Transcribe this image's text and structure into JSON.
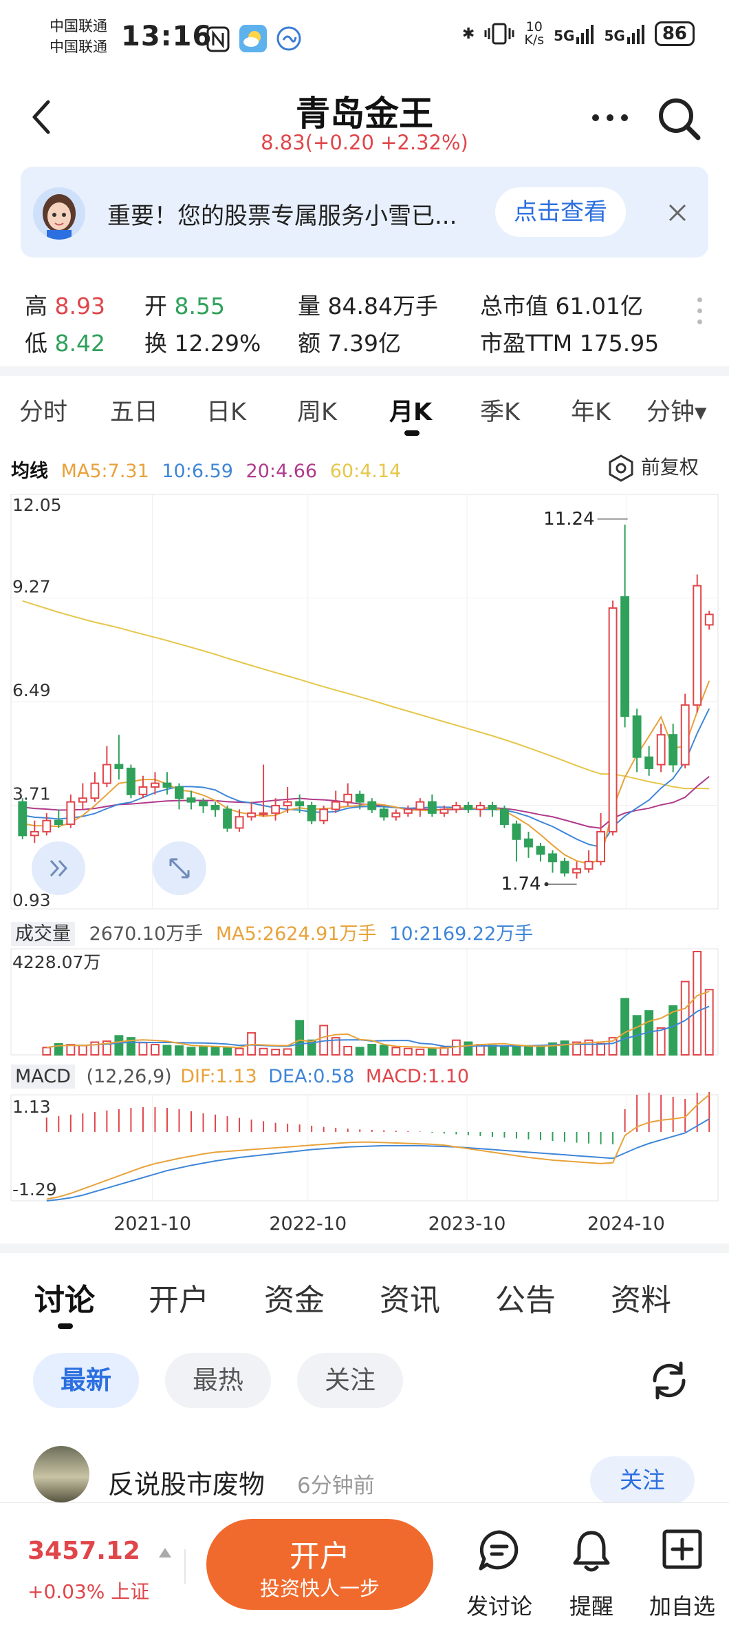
{
  "status_bar": {
    "carrier1": "中国联通",
    "carrier2": "中国联通",
    "time": "13:16",
    "net_speed_top": "10",
    "net_speed_unit": "K/s",
    "signal1": "5G",
    "signal2": "5G",
    "battery": "86"
  },
  "header": {
    "title": "青岛金王",
    "price_line": "8.83(+0.20 +2.32%)"
  },
  "banner": {
    "text": "重要！您的股票专属服务小雪已...",
    "button": "点击查看"
  },
  "quote": {
    "high_label": "高",
    "high_value": "8.93",
    "low_label": "低",
    "low_value": "8.42",
    "open_label": "开",
    "open_value": "8.55",
    "turnover_label": "换",
    "turnover_value": "12.29%",
    "volume_label": "量",
    "volume_value": "84.84万手",
    "amount_label": "额",
    "amount_value": "7.39亿",
    "mcap_label": "总市值",
    "mcap_value": "61.01亿",
    "pe_label": "市盈TTM",
    "pe_value": "175.95"
  },
  "period_tabs": [
    "分时",
    "五日",
    "日K",
    "周K",
    "月K",
    "季K",
    "年K",
    "分钟▾"
  ],
  "active_period": "月K",
  "ma_legend": {
    "label": "均线",
    "ma5": "MA5:7.31",
    "ma10": "10:6.59",
    "ma20": "20:4.66",
    "ma60": "60:4.14",
    "restore": "前复权"
  },
  "volume_legend": {
    "label": "成交量",
    "vol": "2670.10万手",
    "ma5": "MA5:2624.91万手",
    "ma10": "10:2169.22万手"
  },
  "macd_legend": {
    "label": "MACD",
    "params": "(12,26,9)",
    "dif": "DIF:1.13",
    "dea": "DEA:0.58",
    "macd": "MACD:1.10"
  },
  "colors": {
    "up": "#e0454a",
    "down": "#2fa15a",
    "ma5": "#e8a23a",
    "ma10": "#3f86d8",
    "ma20": "#b03a8c",
    "ma60": "#e6c64a",
    "accent": "#2b6fe0",
    "cta": "#f16a2d"
  },
  "chart_data": [
    {
      "type": "candlestick",
      "title": "",
      "y_ticks": [
        "12.05",
        "9.27",
        "6.49",
        "3.71",
        "0.93"
      ],
      "ylim": [
        0.93,
        12.05
      ],
      "x_ticks": [
        "2021-10",
        "2022-10",
        "2023-10",
        "2024-10"
      ],
      "annotations": [
        "11.24",
        "1.74"
      ],
      "candles": [
        {
          "o": 3.8,
          "c": 2.9,
          "h": 3.9,
          "l": 2.8
        },
        {
          "o": 2.9,
          "c": 3.0,
          "h": 3.3,
          "l": 2.7
        },
        {
          "o": 3.0,
          "c": 3.3,
          "h": 3.5,
          "l": 2.9
        },
        {
          "o": 3.3,
          "c": 3.2,
          "h": 3.6,
          "l": 3.1
        },
        {
          "o": 3.2,
          "c": 3.8,
          "h": 4.0,
          "l": 3.1
        },
        {
          "o": 3.8,
          "c": 3.9,
          "h": 4.3,
          "l": 3.6
        },
        {
          "o": 3.9,
          "c": 4.3,
          "h": 4.6,
          "l": 3.8
        },
        {
          "o": 4.3,
          "c": 4.8,
          "h": 5.3,
          "l": 4.2
        },
        {
          "o": 4.8,
          "c": 4.7,
          "h": 5.6,
          "l": 4.4
        },
        {
          "o": 4.7,
          "c": 4.0,
          "h": 4.8,
          "l": 3.9
        },
        {
          "o": 4.0,
          "c": 4.2,
          "h": 4.5,
          "l": 3.9
        },
        {
          "o": 4.2,
          "c": 4.3,
          "h": 4.6,
          "l": 4.0
        },
        {
          "o": 4.3,
          "c": 4.2,
          "h": 4.6,
          "l": 4.0
        },
        {
          "o": 4.2,
          "c": 3.9,
          "h": 4.3,
          "l": 3.6
        },
        {
          "o": 3.9,
          "c": 3.8,
          "h": 4.1,
          "l": 3.6
        },
        {
          "o": 3.8,
          "c": 3.7,
          "h": 3.9,
          "l": 3.5
        },
        {
          "o": 3.7,
          "c": 3.6,
          "h": 3.8,
          "l": 3.4
        },
        {
          "o": 3.6,
          "c": 3.1,
          "h": 3.7,
          "l": 3.0
        },
        {
          "o": 3.1,
          "c": 3.4,
          "h": 3.6,
          "l": 3.0
        },
        {
          "o": 3.4,
          "c": 3.5,
          "h": 3.8,
          "l": 3.3
        },
        {
          "o": 3.5,
          "c": 3.5,
          "h": 4.8,
          "l": 3.4
        },
        {
          "o": 3.5,
          "c": 3.7,
          "h": 3.9,
          "l": 3.3
        },
        {
          "o": 3.7,
          "c": 3.8,
          "h": 4.2,
          "l": 3.5
        },
        {
          "o": 3.8,
          "c": 3.7,
          "h": 4.0,
          "l": 3.5
        },
        {
          "o": 3.7,
          "c": 3.3,
          "h": 3.8,
          "l": 3.2
        },
        {
          "o": 3.3,
          "c": 3.6,
          "h": 3.7,
          "l": 3.2
        },
        {
          "o": 3.6,
          "c": 3.8,
          "h": 4.1,
          "l": 3.5
        },
        {
          "o": 3.8,
          "c": 4.0,
          "h": 4.3,
          "l": 3.7
        },
        {
          "o": 4.0,
          "c": 3.8,
          "h": 4.1,
          "l": 3.6
        },
        {
          "o": 3.8,
          "c": 3.6,
          "h": 3.9,
          "l": 3.5
        },
        {
          "o": 3.6,
          "c": 3.4,
          "h": 3.7,
          "l": 3.3
        },
        {
          "o": 3.4,
          "c": 3.5,
          "h": 3.6,
          "l": 3.3
        },
        {
          "o": 3.5,
          "c": 3.6,
          "h": 3.7,
          "l": 3.4
        },
        {
          "o": 3.6,
          "c": 3.8,
          "h": 3.9,
          "l": 3.4
        },
        {
          "o": 3.8,
          "c": 3.5,
          "h": 4.0,
          "l": 3.4
        },
        {
          "o": 3.5,
          "c": 3.6,
          "h": 3.7,
          "l": 3.4
        },
        {
          "o": 3.6,
          "c": 3.7,
          "h": 3.8,
          "l": 3.5
        },
        {
          "o": 3.7,
          "c": 3.6,
          "h": 3.8,
          "l": 3.5
        },
        {
          "o": 3.6,
          "c": 3.7,
          "h": 3.8,
          "l": 3.4
        },
        {
          "o": 3.7,
          "c": 3.6,
          "h": 3.8,
          "l": 3.4
        },
        {
          "o": 3.6,
          "c": 3.2,
          "h": 3.7,
          "l": 3.1
        },
        {
          "o": 3.2,
          "c": 2.8,
          "h": 3.3,
          "l": 2.2
        },
        {
          "o": 2.8,
          "c": 2.6,
          "h": 3.0,
          "l": 2.3
        },
        {
          "o": 2.6,
          "c": 2.4,
          "h": 2.7,
          "l": 2.2
        },
        {
          "o": 2.4,
          "c": 2.2,
          "h": 2.5,
          "l": 1.9
        },
        {
          "o": 2.2,
          "c": 1.9,
          "h": 2.3,
          "l": 1.8
        },
        {
          "o": 1.9,
          "c": 2.0,
          "h": 2.2,
          "l": 1.74
        },
        {
          "o": 2.0,
          "c": 2.2,
          "h": 2.5,
          "l": 1.9
        },
        {
          "o": 2.2,
          "c": 3.0,
          "h": 3.5,
          "l": 2.1
        },
        {
          "o": 3.0,
          "c": 9.0,
          "h": 9.2,
          "l": 2.9
        },
        {
          "o": 9.3,
          "c": 6.1,
          "h": 11.24,
          "l": 5.8
        },
        {
          "o": 6.1,
          "c": 5.0,
          "h": 6.3,
          "l": 4.6
        },
        {
          "o": 5.0,
          "c": 4.7,
          "h": 5.3,
          "l": 4.5
        },
        {
          "o": 4.8,
          "c": 5.6,
          "h": 5.9,
          "l": 4.6
        },
        {
          "o": 5.6,
          "c": 4.8,
          "h": 5.9,
          "l": 4.6
        },
        {
          "o": 4.8,
          "c": 6.4,
          "h": 6.7,
          "l": 4.7
        },
        {
          "o": 6.4,
          "c": 9.6,
          "h": 9.9,
          "l": 6.2
        },
        {
          "o": 8.55,
          "c": 8.83,
          "h": 8.93,
          "l": 8.42
        }
      ]
    },
    {
      "type": "bar",
      "title": "",
      "y_ticks": [
        "4228.07万"
      ],
      "unit": "万手",
      "values": [
        300,
        450,
        420,
        380,
        520,
        560,
        780,
        700,
        500,
        420,
        380,
        360,
        300,
        350,
        330,
        280,
        260,
        900,
        260,
        220,
        240,
        1400,
        600,
        1200,
        700,
        340,
        300,
        420,
        380,
        300,
        260,
        230,
        260,
        300,
        600,
        520,
        420,
        380,
        360,
        320,
        360,
        340,
        480,
        560,
        520,
        600,
        460,
        700,
        2300,
        1600,
        1800,
        1100,
        2000,
        3000,
        4228,
        2670
      ],
      "directions": [
        "d",
        "u",
        "u",
        "d",
        "u",
        "u",
        "u",
        "u",
        "d",
        "d",
        "u",
        "u",
        "d",
        "d",
        "d",
        "d",
        "d",
        "d",
        "u",
        "u",
        "u",
        "d",
        "u",
        "u",
        "d",
        "u",
        "u",
        "u",
        "d",
        "d",
        "d",
        "u",
        "u",
        "u",
        "d",
        "u",
        "u",
        "d",
        "u",
        "d",
        "d",
        "d",
        "d",
        "d",
        "d",
        "d",
        "u",
        "u",
        "u",
        "d",
        "d",
        "d",
        "u",
        "d",
        "u",
        "u",
        "u",
        "d"
      ]
    },
    {
      "type": "bar",
      "title": "",
      "y_ticks": [
        "1.13",
        "-1.29"
      ],
      "ylim": [
        -1.29,
        1.13
      ],
      "hist": [
        0.35,
        0.38,
        0.42,
        0.45,
        0.48,
        0.52,
        0.55,
        0.58,
        0.6,
        0.6,
        0.58,
        0.55,
        0.5,
        0.45,
        0.42,
        0.38,
        0.34,
        0.3,
        0.26,
        0.22,
        0.2,
        0.18,
        0.15,
        0.12,
        0.1,
        0.08,
        0.06,
        0.05,
        0.04,
        0.03,
        0.02,
        0.01,
        -0.02,
        -0.04,
        -0.06,
        -0.08,
        -0.1,
        -0.12,
        -0.14,
        -0.16,
        -0.18,
        -0.2,
        -0.22,
        -0.24,
        -0.26,
        -0.28,
        -0.3,
        -0.3,
        0.55,
        0.9,
        0.95,
        0.9,
        0.85,
        0.8,
        0.95,
        1.1
      ],
      "dif": [
        -1.25,
        -1.2,
        -1.12,
        -1.02,
        -0.92,
        -0.82,
        -0.72,
        -0.62,
        -0.52,
        -0.44,
        -0.38,
        -0.32,
        -0.27,
        -0.22,
        -0.18,
        -0.16,
        -0.14,
        -0.12,
        -0.1,
        -0.08,
        -0.06,
        -0.04,
        -0.02,
        0.0,
        0.02,
        0.04,
        0.05,
        0.05,
        0.04,
        0.03,
        0.02,
        0.01,
        0.0,
        -0.02,
        -0.06,
        -0.1,
        -0.14,
        -0.18,
        -0.22,
        -0.26,
        -0.3,
        -0.33,
        -0.36,
        -0.38,
        -0.4,
        -0.42,
        -0.44,
        -0.42,
        0.2,
        0.4,
        0.5,
        0.55,
        0.58,
        0.62,
        0.9,
        1.13
      ],
      "dea": [
        -1.29,
        -1.26,
        -1.22,
        -1.16,
        -1.08,
        -1.0,
        -0.92,
        -0.84,
        -0.76,
        -0.68,
        -0.6,
        -0.54,
        -0.48,
        -0.43,
        -0.38,
        -0.34,
        -0.3,
        -0.27,
        -0.24,
        -0.21,
        -0.18,
        -0.15,
        -0.12,
        -0.1,
        -0.08,
        -0.06,
        -0.05,
        -0.04,
        -0.03,
        -0.03,
        -0.03,
        -0.03,
        -0.04,
        -0.05,
        -0.06,
        -0.08,
        -0.1,
        -0.12,
        -0.14,
        -0.16,
        -0.18,
        -0.2,
        -0.22,
        -0.24,
        -0.26,
        -0.28,
        -0.3,
        -0.32,
        -0.2,
        -0.08,
        0.02,
        0.1,
        0.18,
        0.26,
        0.42,
        0.58
      ]
    }
  ],
  "detail_tabs": [
    "讨论",
    "开户",
    "资金",
    "资讯",
    "公告",
    "资料"
  ],
  "sort_pills": [
    "最新",
    "最热",
    "关注"
  ],
  "post": {
    "author": "反说股市废物",
    "time": "6分钟前",
    "follow": "关注"
  },
  "bottom_bar": {
    "index_value": "3457.12",
    "index_change": "+0.03% 上证",
    "open_account": "开户",
    "open_account_sub": "投资快人一步",
    "discuss": "发讨论",
    "remind": "提醒",
    "add_watch": "加自选"
  }
}
